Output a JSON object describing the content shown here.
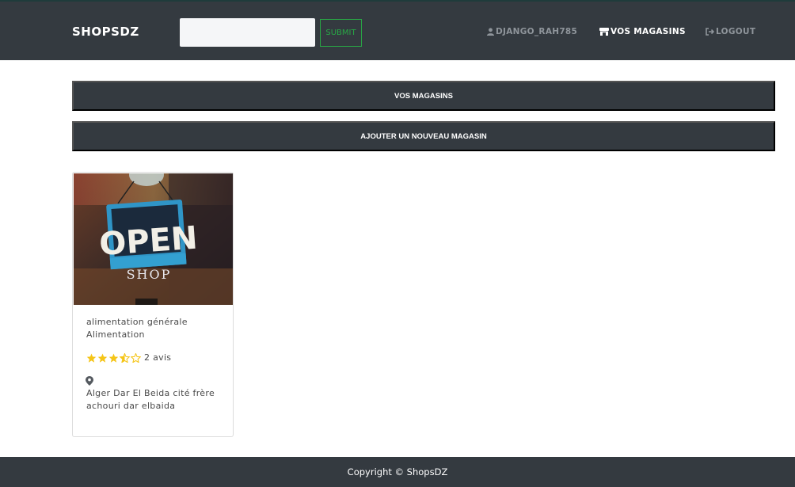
{
  "navbar": {
    "brand": "SHOPSDZ",
    "search": {
      "value": "",
      "placeholder": ""
    },
    "submit_label": "SUBMIT",
    "links": [
      {
        "label": "DJANGO_RAH785",
        "icon": "user-icon",
        "active": false
      },
      {
        "label": "VOS MAGASINS",
        "icon": "store-icon",
        "active": true
      },
      {
        "label": "LOGOUT",
        "icon": "sign-out-icon",
        "active": false
      }
    ]
  },
  "actions": {
    "my_shops": "VOS MAGASINS",
    "add_shop": "AJOUTER UN NOUVEAU MAGASIN"
  },
  "shops": [
    {
      "image_icon": "open-shop-sign-photo",
      "image_sign_text": "OPEN",
      "image_sign_subtext": "SHOP",
      "name": "alimentation générale",
      "category": "Alimentation",
      "rating": 3.5,
      "rating_max": 5,
      "reviews": "2 avis",
      "location_icon": "map-marker-icon",
      "address_line1": "Alger Dar El Beida cité frère",
      "address_line2": "achouri dar elbaida"
    }
  ],
  "footer": {
    "copyright": "Copyright © ShopsDZ"
  },
  "colors": {
    "dark": "#343a40",
    "success": "#28a745",
    "star": "#f5c518",
    "muted": "#8f959b"
  }
}
